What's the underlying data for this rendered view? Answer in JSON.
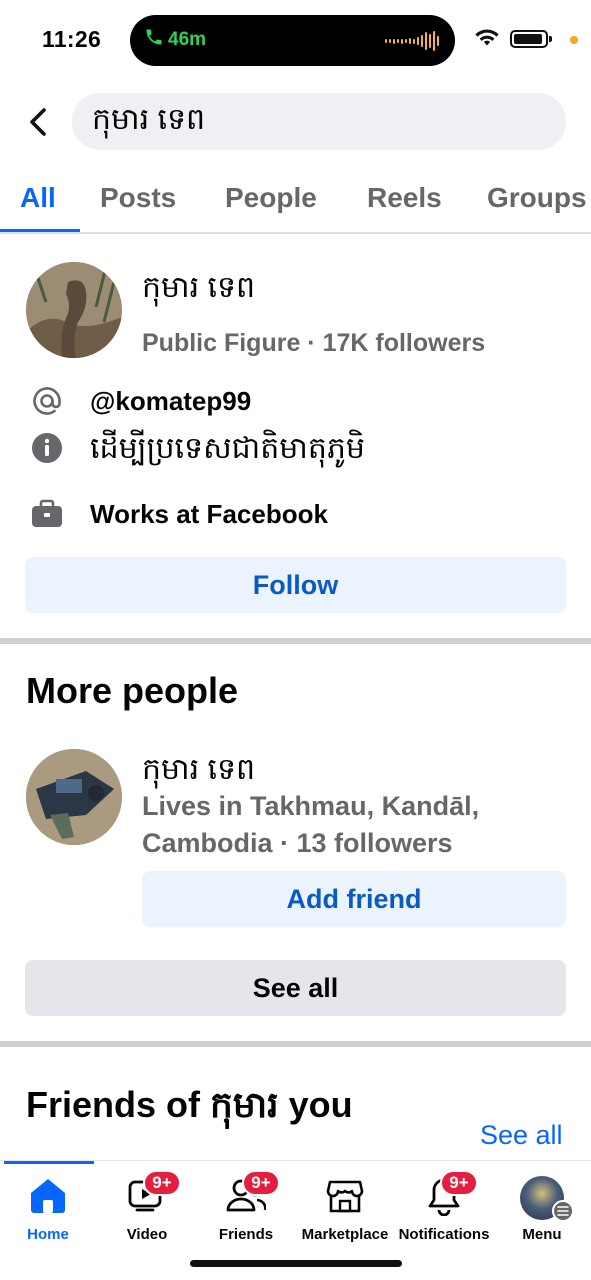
{
  "status_bar": {
    "time": "11:26",
    "call_duration": "46m",
    "accent_call": "#30d158"
  },
  "search": {
    "query": "កុមារ ទេព",
    "back_icon": "chevron-left-icon"
  },
  "tabs": [
    {
      "label": "All",
      "active": true
    },
    {
      "label": "Posts",
      "active": false
    },
    {
      "label": "People",
      "active": false
    },
    {
      "label": "Reels",
      "active": false
    },
    {
      "label": "Groups",
      "active": false
    }
  ],
  "profile": {
    "name": "កុមារ ទេព",
    "subtitle": "Public Figure · 17K followers",
    "handle": "@komatep99",
    "about": "ដើម្បីប្រទេសជាតិមាតុភូមិ",
    "work": "Works at Facebook",
    "follow_label": "Follow"
  },
  "more_people": {
    "heading": "More people",
    "person": {
      "name": "កុមារ ទេព",
      "info": "Lives in Takhmau, Kandāl, Cambodia · 13 followers",
      "add_friend_label": "Add friend"
    },
    "see_all_label": "See all"
  },
  "friends_of": {
    "heading": "Friends of កុមារ you",
    "see_all_label": "See all"
  },
  "bottom_nav": [
    {
      "label": "Home",
      "icon": "home-icon",
      "badge": "",
      "active": true
    },
    {
      "label": "Video",
      "icon": "video-icon",
      "badge": "9+",
      "active": false
    },
    {
      "label": "Friends",
      "icon": "friends-icon",
      "badge": "9+",
      "active": false
    },
    {
      "label": "Marketplace",
      "icon": "marketplace-icon",
      "badge": "",
      "active": false
    },
    {
      "label": "Notifications",
      "icon": "bell-icon",
      "badge": "9+",
      "active": false
    },
    {
      "label": "Menu",
      "icon": "menu-avatar",
      "badge": "",
      "active": false
    }
  ],
  "colors": {
    "accent": "#0866ff",
    "secondary_text": "#65676b",
    "badge": "#e41e3f",
    "button_light": "#ebf3ff"
  }
}
